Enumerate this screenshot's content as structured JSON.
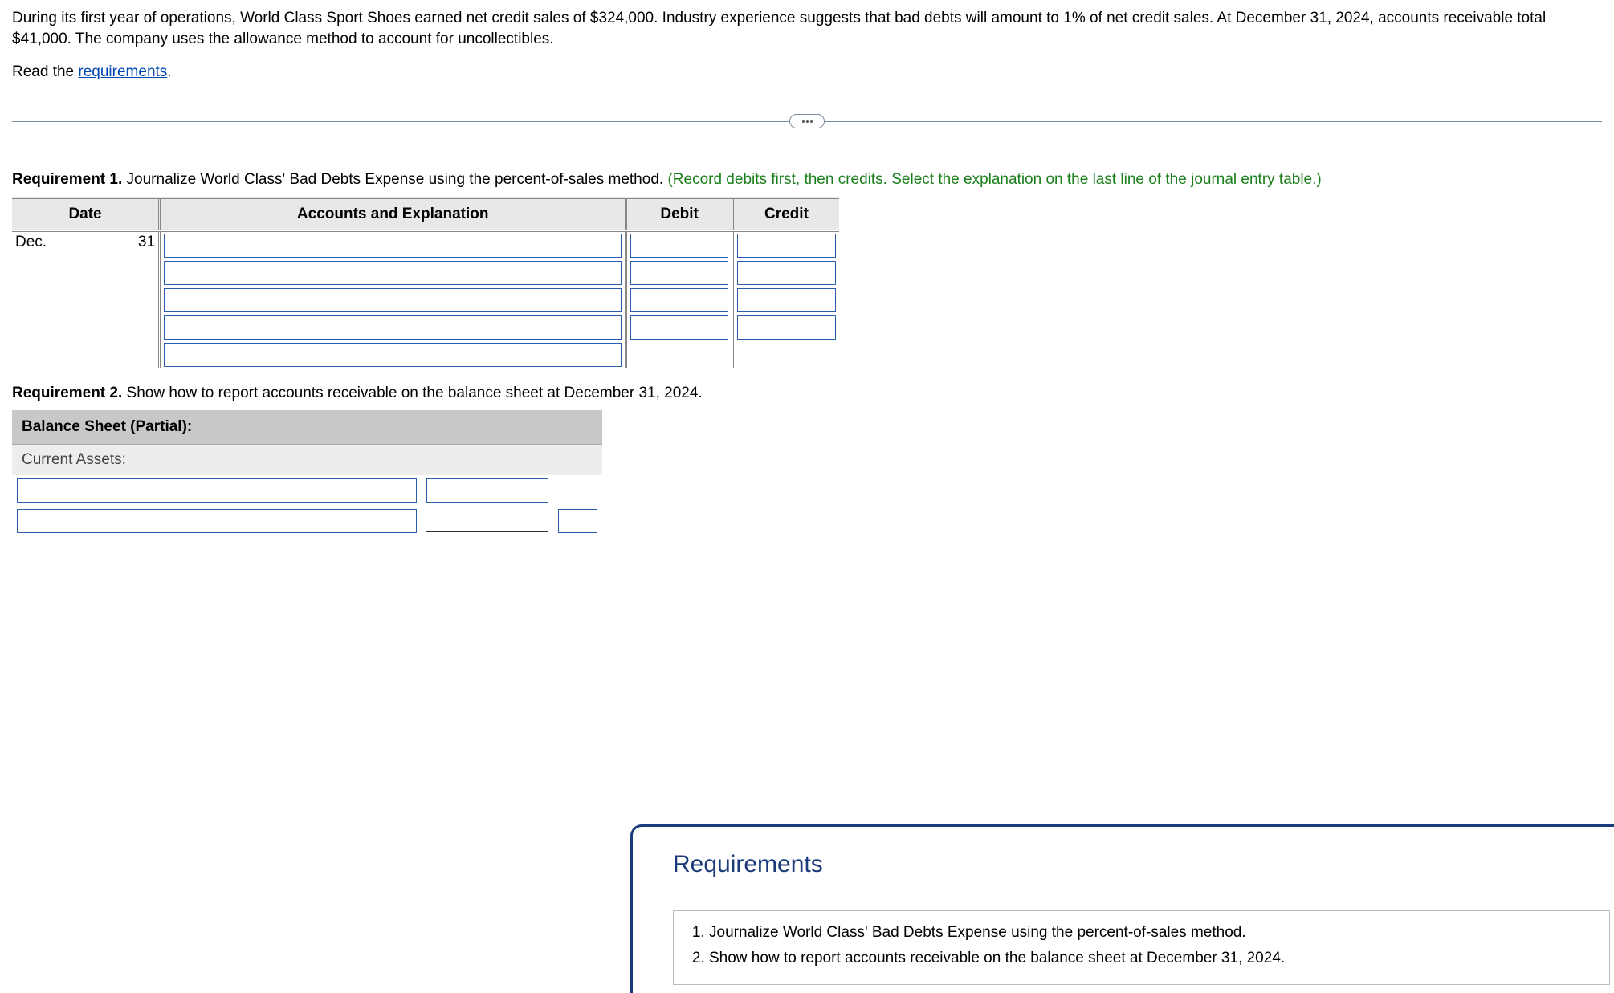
{
  "problem": {
    "text": "During its first year of operations, World Class Sport Shoes earned net credit sales of $324,000. Industry experience suggests that bad debts will amount to 1% of net credit sales. At December 31, 2024, accounts receivable total $41,000. The company uses the allowance method to account for uncollectibles.",
    "read_prefix": "Read the ",
    "requirements_link": "requirements",
    "period": "."
  },
  "req1": {
    "label": "Requirement 1.",
    "text": " Journalize World Class' Bad Debts Expense using the percent-of-sales method. ",
    "hint": "(Record debits first, then credits. Select the explanation on the last line of the journal entry table.)"
  },
  "journal": {
    "headers": {
      "date": "Date",
      "accounts": "Accounts and Explanation",
      "debit": "Debit",
      "credit": "Credit"
    },
    "date_month": "Dec.",
    "date_day": "31"
  },
  "req2": {
    "label": "Requirement 2.",
    "text": " Show how to report accounts receivable on the balance sheet at December 31, 2024."
  },
  "balance": {
    "title": "Balance Sheet (Partial):",
    "subtitle": "Current Assets:"
  },
  "popup": {
    "title": "Requirements",
    "items": [
      "Journalize World Class' Bad Debts Expense using the percent-of-sales method.",
      "Show how to report accounts receivable on the balance sheet at December 31, 2024."
    ]
  }
}
